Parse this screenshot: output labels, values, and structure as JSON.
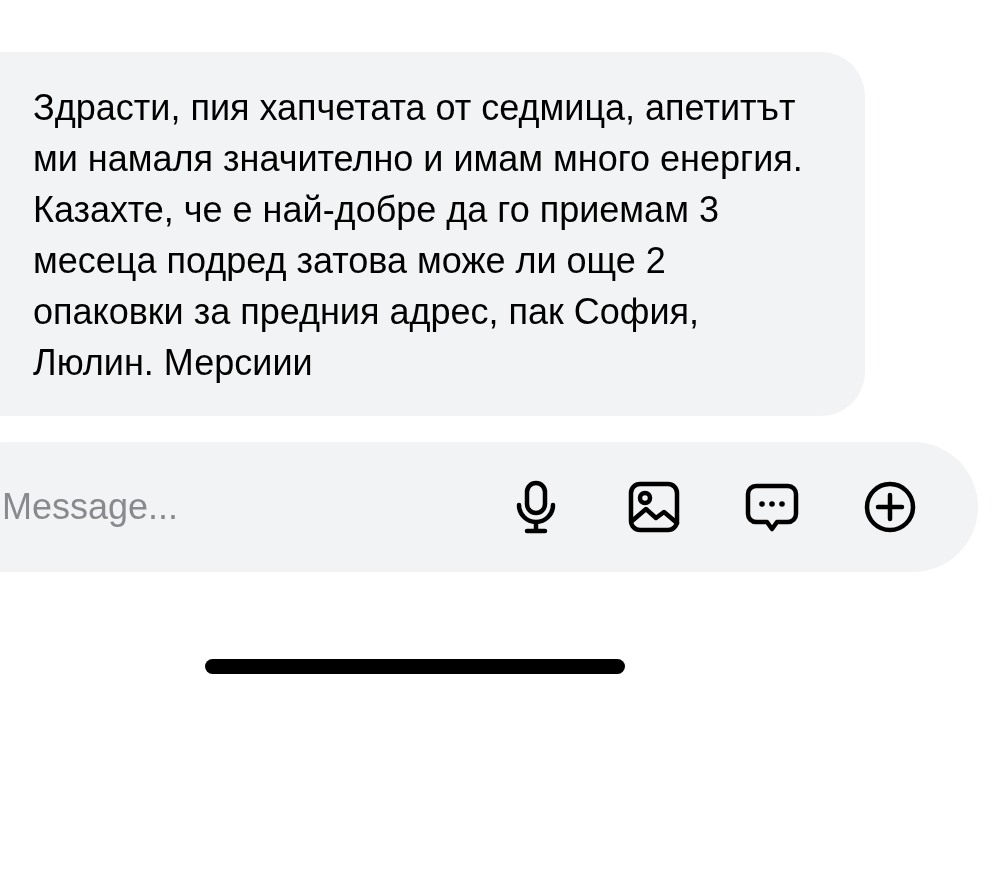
{
  "message": {
    "text": "Здрасти, пия хапчетата от седмица, апетитът ми намаля значително и имам много енергия. Казахте, че е най-добре да го приемам 3 месеца подред затова може ли още 2 опаковки за предния адрес, пак София, Люлин. Мерсиии"
  },
  "composer": {
    "placeholder": "Message...",
    "actions": [
      {
        "kind": "mic"
      },
      {
        "kind": "image"
      },
      {
        "kind": "chat"
      },
      {
        "kind": "plus"
      }
    ]
  }
}
